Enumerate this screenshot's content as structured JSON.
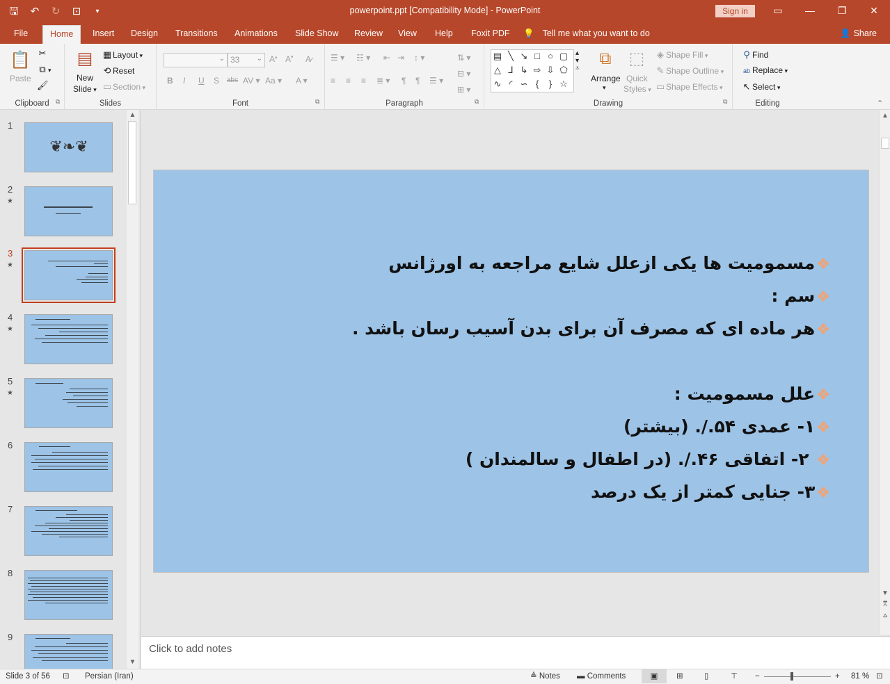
{
  "window": {
    "title": "powerpoint.ppt [Compatibility Mode]  -  PowerPoint",
    "sign_in": "Sign in",
    "qat_icons": [
      "save-icon",
      "undo-icon",
      "redo-icon",
      "presentation-icon",
      "customize-icon"
    ]
  },
  "tabs": [
    "File",
    "Home",
    "Insert",
    "Design",
    "Transitions",
    "Animations",
    "Slide Show",
    "Review",
    "View",
    "Help",
    "Foxit PDF"
  ],
  "active_tab": "Home",
  "tell_me": "Tell me what you want to do",
  "share": "Share",
  "ribbon": {
    "clipboard": {
      "label": "Clipboard",
      "paste": "Paste"
    },
    "slides": {
      "label": "Slides",
      "new_slide": "New",
      "new_slide2": "Slide",
      "layout": "Layout",
      "reset": "Reset",
      "section": "Section"
    },
    "font": {
      "label": "Font",
      "size": "33"
    },
    "paragraph": {
      "label": "Paragraph"
    },
    "drawing": {
      "label": "Drawing",
      "arrange": "Arrange",
      "quick_styles": "Quick",
      "quick_styles2": "Styles",
      "shape_fill": "Shape Fill",
      "shape_outline": "Shape Outline",
      "shape_effects": "Shape Effects"
    },
    "editing": {
      "label": "Editing",
      "find": "Find",
      "replace": "Replace",
      "select": "Select"
    }
  },
  "thumbnails": [
    {
      "num": "1",
      "star": false
    },
    {
      "num": "2",
      "star": true
    },
    {
      "num": "3",
      "star": true
    },
    {
      "num": "4",
      "star": true
    },
    {
      "num": "5",
      "star": true
    },
    {
      "num": "6",
      "star": false
    },
    {
      "num": "7",
      "star": false
    },
    {
      "num": "8",
      "star": false
    },
    {
      "num": "9",
      "star": false
    }
  ],
  "active_slide": "3",
  "slide": {
    "bullets": [
      "مسمومیت ها یکی ازعلل شایع مراجعه به اورژانس",
      "سم :",
      "هر ماده ای که مصرف آن برای بدن آسیب رسان باشد .",
      "",
      "علل مسمومیت :",
      "۱- عمدی ۵۴./. (بیشتر)",
      " ۲- اتفاقی ۴۶./. (در اطفال و سالمندان )",
      "۳- جنایی کمتر از یک درصد"
    ],
    "bullet_color": "#f4a270",
    "background": "#9dc3e6"
  },
  "notes_placeholder": "Click to add notes",
  "status": {
    "slide_counter": "Slide 3 of 56",
    "language": "Persian (Iran)",
    "notes": "Notes",
    "comments": "Comments",
    "zoom_minus": "−",
    "zoom_plus": "+",
    "zoom_level": "81 %"
  },
  "colors": {
    "accent": "#b7472a",
    "active_thumb": "#c43e1c"
  }
}
